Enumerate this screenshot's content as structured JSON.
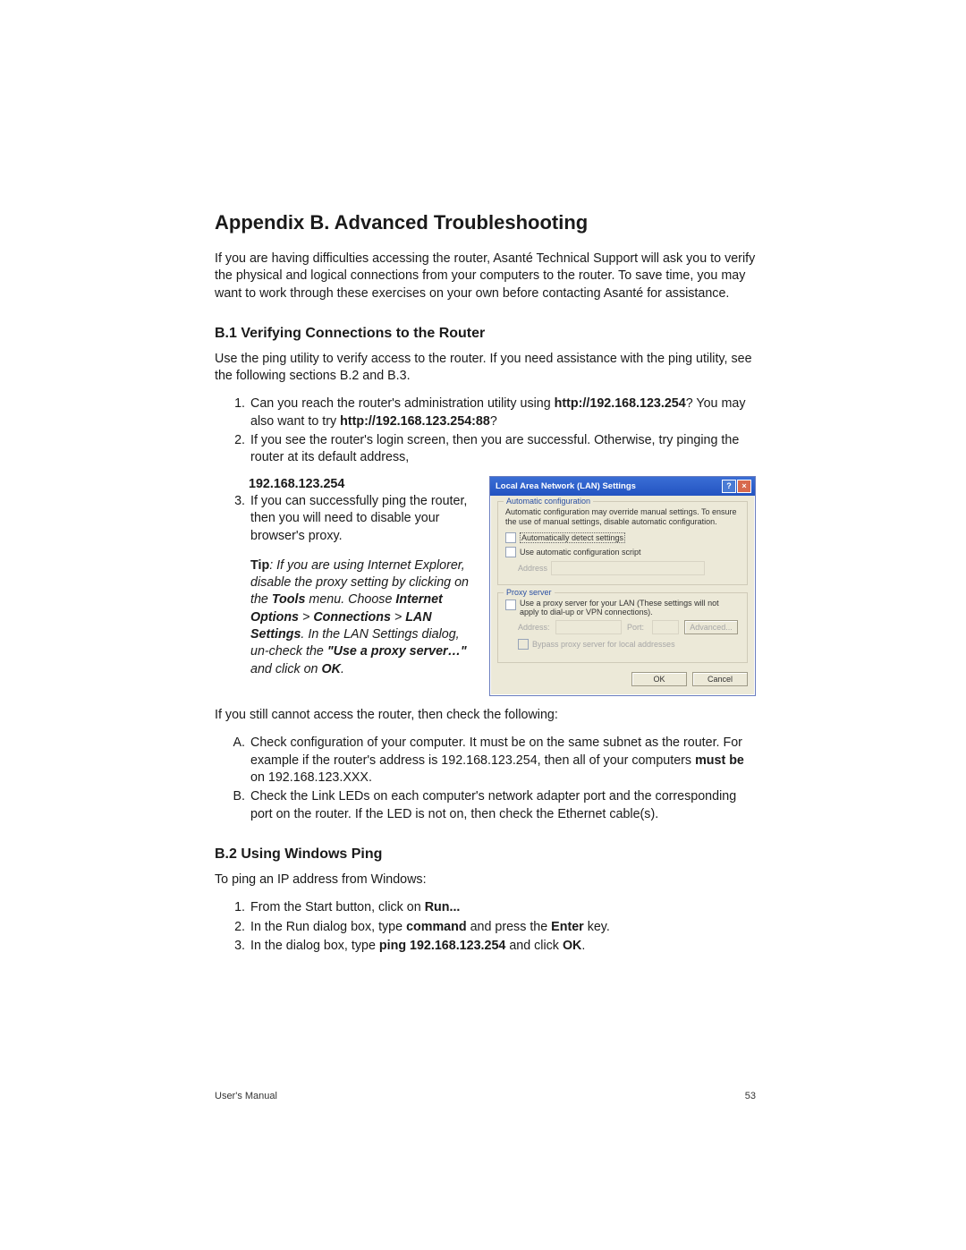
{
  "heading": "Appendix B. Advanced Troubleshooting",
  "intro": "If you are having difficulties accessing the router, Asanté Technical Support will ask you to verify the physical and logical connections from your computers to the router. To save time, you may want to work through these exercises on your own before contacting Asanté for assistance.",
  "section_b1": {
    "title": "B.1 Verifying Connections to the Router",
    "intro": "Use the ping utility to verify access to the router. If you need assistance with the ping utility, see the following sections B.2 and B.3.",
    "item1_part1": "Can you reach the router's administration utility using ",
    "item1_bold1": "http://192.168.123.254",
    "item1_part2": "? You may also want to try ",
    "item1_bold2": "http://192.168.123.254:88",
    "item1_part3": "?",
    "item2": "If you see the router's login screen, then you are successful. Otherwise, try pinging the router at its default address,",
    "item2_bold": "192.168.123.254",
    "item3": "If you can successfully ping the router, then you will need to disable your browser's proxy.",
    "tip_label": "Tip",
    "tip_body1": ": If you are using Internet Explorer, disable the proxy setting by clicking on the ",
    "tip_bold1": "Tools",
    "tip_body2": " menu. Choose ",
    "tip_bold2": "Internet Options",
    "tip_sep1": "  >  ",
    "tip_bold3": "Connections",
    "tip_sep2": " > ",
    "tip_bold4": "LAN Settings",
    "tip_body3": ". In the LAN Settings dialog, un-check the ",
    "tip_quote": "\"Use a proxy server…\"",
    "tip_body4": " and click on ",
    "tip_bold5": "OK",
    "tip_body5": ".",
    "after_tip": "If you still cannot access the router, then check the following:",
    "itemA_part1": "Check configuration of your computer. It must be on the same subnet as the router. For example if the router's address is 192.168.123.254, then all of your computers ",
    "itemA_bold": "must be",
    "itemA_part2": " on 192.168.123.XXX.",
    "itemB": "Check the Link LEDs on each computer's network adapter port and the corresponding port on the router. If the LED is not on, then check the Ethernet cable(s)."
  },
  "section_b2": {
    "title": "B.2 Using Windows Ping",
    "intro": "To ping an IP address from Windows:",
    "item1_part1": "From the Start button, click on ",
    "item1_bold": "Run...",
    "item2_part1": "In the Run dialog box, type ",
    "item2_bold1": "command",
    "item2_part2": " and press the ",
    "item2_bold2": "Enter",
    "item2_part3": " key.",
    "item3_part1": "In the dialog box, type ",
    "item3_bold1": "ping 192.168.123.254",
    "item3_part2": " and click ",
    "item3_bold2": "OK",
    "item3_part3": "."
  },
  "dialog": {
    "title": "Local Area Network (LAN) Settings",
    "auto_label": "Automatic configuration",
    "auto_text": "Automatic configuration may override manual settings. To ensure the use of manual settings, disable automatic configuration.",
    "auto_chk1": "Automatically detect settings",
    "auto_chk2": "Use automatic configuration script",
    "address_label": "Address",
    "proxy_label": "Proxy server",
    "proxy_chk": "Use a proxy server for your LAN (These settings will not apply to dial-up or VPN connections).",
    "addr_lbl": "Address:",
    "port_lbl": "Port:",
    "advanced": "Advanced...",
    "bypass": "Bypass proxy server for local addresses",
    "ok": "OK",
    "cancel": "Cancel"
  },
  "footer": {
    "left": "User's Manual",
    "right": "53"
  }
}
